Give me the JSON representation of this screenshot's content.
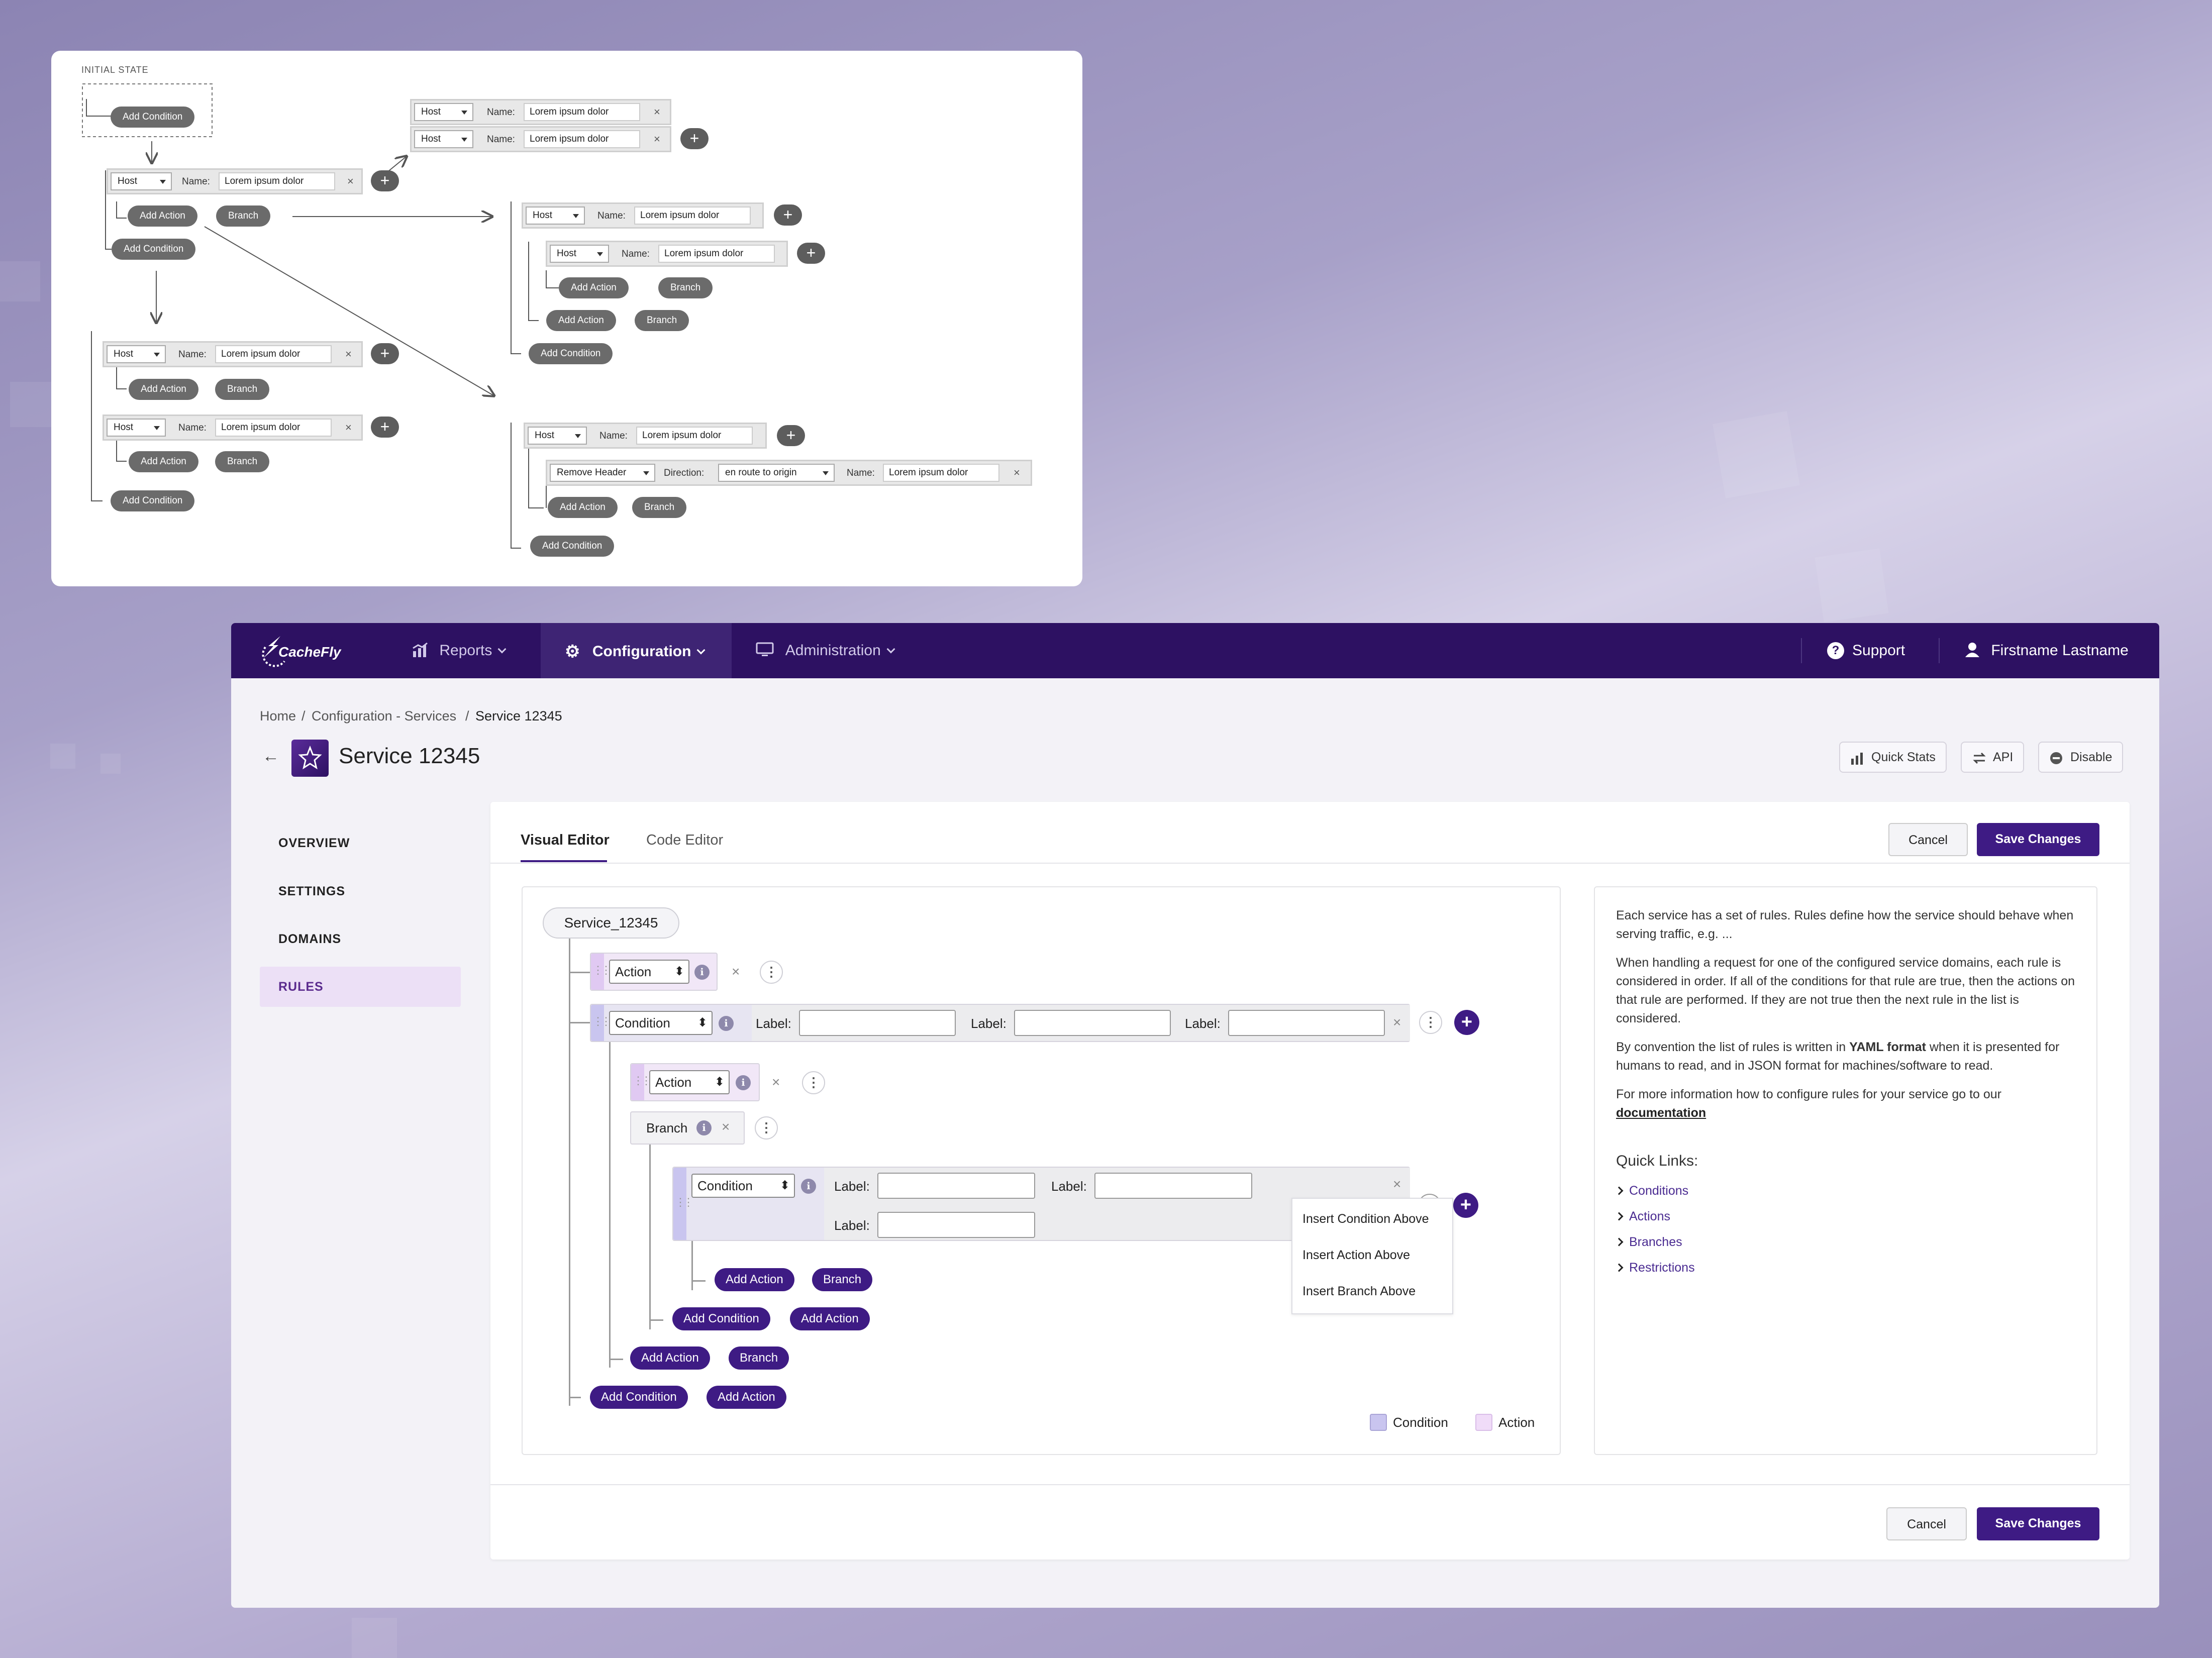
{
  "wireframe": {
    "initial_state_label": "INITIAL STATE",
    "add_condition": "Add Condition",
    "add_action": "Add Action",
    "branch": "Branch",
    "host": "Host",
    "name_label": "Name:",
    "name_value": "Lorem ipsum dolor",
    "remove_header": "Remove Header",
    "direction_label": "Direction:",
    "direction_value": "en route to origin",
    "close": "×",
    "plus": "+"
  },
  "app": {
    "brand": "CacheFly",
    "nav": {
      "reports": "Reports",
      "configuration": "Configuration",
      "administration": "Administration",
      "support": "Support",
      "user": "Firstname Lastname"
    },
    "breadcrumb": [
      "Home",
      "/",
      "Configuration - Services",
      "/",
      "Service 12345"
    ],
    "page_title": "Service 12345",
    "header_buttons": {
      "quick_stats": "Quick Stats",
      "api": "API",
      "disable": "Disable"
    },
    "sidebar": [
      "OVERVIEW",
      "SETTINGS",
      "DOMAINS",
      "RULES"
    ],
    "tabs": [
      "Visual Editor",
      "Code Editor"
    ],
    "cancel": "Cancel",
    "save": "Save Changes",
    "editor": {
      "root": "Service_12345",
      "action": "Action",
      "condition": "Condition",
      "branch": "Branch",
      "label": "Label:",
      "info": "i",
      "close": "×",
      "kebab": "⋮",
      "plus": "+",
      "add_action": "Add Action",
      "add_condition": "Add Condition",
      "branch_btn": "Branch",
      "menu": [
        "Insert Condition Above",
        "Insert Action Above",
        "Insert Branch Above"
      ],
      "legend": {
        "condition": "Condition",
        "action": "Action"
      }
    },
    "info_panel": {
      "p1": "Each service has a set of rules. Rules define how the service should behave when serving traffic, e.g. ...",
      "p2": "When handling a request for one of the configured service domains, each rule is considered in order. If all of the conditions for that rule are true, then the actions on that rule are performed. If they are not true then the next rule in the list is considered.",
      "p3_a": "By convention the list of rules is written in ",
      "p3_b": "YAML format",
      "p3_c": " when it is presented for humans to read, and in JSON format for machines/software to read.",
      "p4": "For more information how to configure rules for your service go to our",
      "p4_link": "documentation",
      "quick_links_title": "Quick Links:",
      "quick_links": [
        "Conditions",
        "Actions",
        "Branches",
        "Restrictions"
      ]
    },
    "colors": {
      "nav_bg": "#2d1162",
      "accent": "#3e1b84",
      "condition": "#c9c5ef",
      "action": "#e0c9f2"
    }
  }
}
